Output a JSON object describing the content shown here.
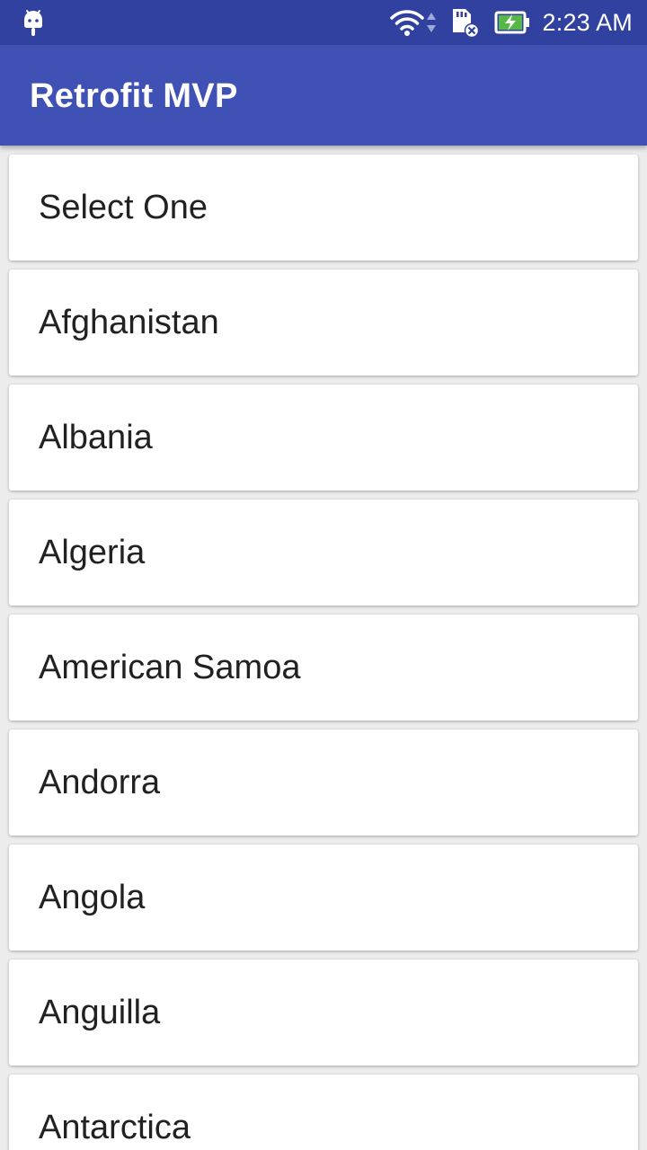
{
  "status_bar": {
    "time": "2:23 AM",
    "icons": [
      "android-icon",
      "wifi-icon",
      "data-activity-icon",
      "sd-card-error-icon",
      "battery-charging-icon"
    ],
    "background_color": "#3041A0"
  },
  "app_bar": {
    "title": "Retrofit MVP",
    "background_color": "#3F51B5"
  },
  "list": {
    "items": [
      "Select One",
      "Afghanistan",
      "Albania",
      "Algeria",
      "American Samoa",
      "Andorra",
      "Angola",
      "Anguilla",
      "Antarctica"
    ]
  }
}
